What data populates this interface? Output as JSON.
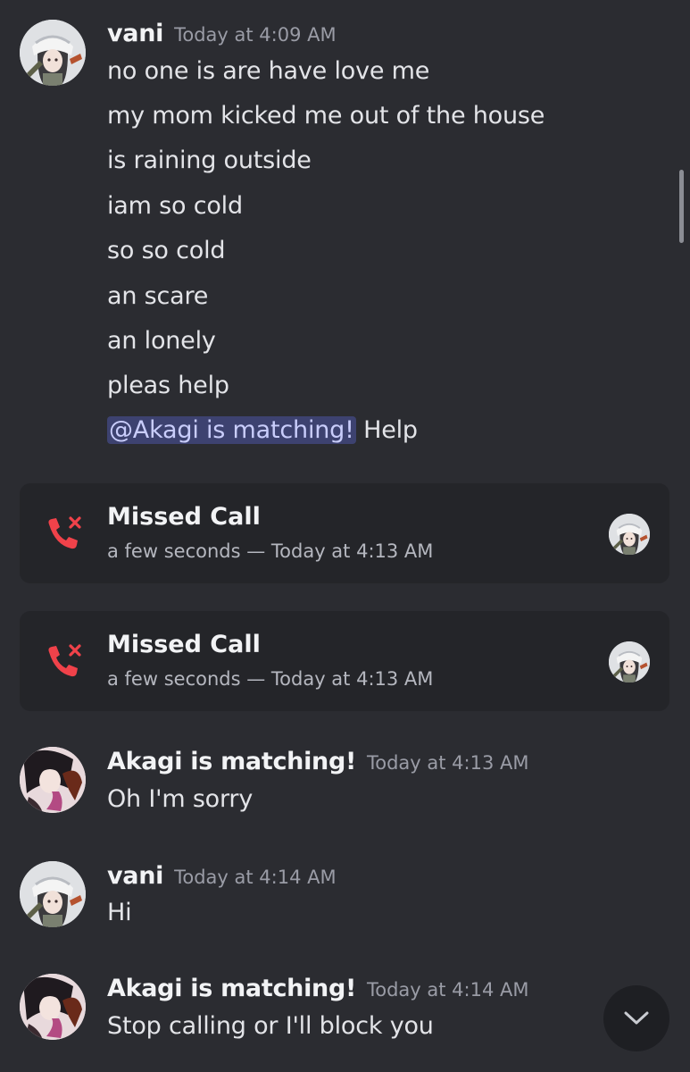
{
  "messages": [
    {
      "author": "vani",
      "timestamp": "Today at 4:09 AM",
      "lines": [
        "no one is are have love me",
        "my mom kicked me out of the house",
        "is raining outside",
        "iam so cold",
        "so so cold",
        "an scare",
        "an lonely",
        "pleas help"
      ],
      "mention": "@Akagi is matching!",
      "mention_trailing": "Help"
    },
    {
      "author": "Akagi is matching!",
      "timestamp": "Today at 4:13 AM",
      "lines": [
        "Oh I'm sorry"
      ]
    },
    {
      "author": "vani",
      "timestamp": "Today at 4:14 AM",
      "lines": [
        "Hi"
      ]
    },
    {
      "author": "Akagi is matching!",
      "timestamp": "Today at 4:14 AM",
      "lines": [
        "Stop calling or I'll block you"
      ]
    }
  ],
  "calls": [
    {
      "title": "Missed Call",
      "meta": "a few seconds — Today at 4:13 AM"
    },
    {
      "title": "Missed Call",
      "meta": "a few seconds — Today at 4:13 AM"
    }
  ],
  "icons": {
    "missed_call": "missed-call-icon",
    "jump_to_present": "chevron-down-icon"
  },
  "colors": {
    "background": "#2b2c31",
    "card": "#242529",
    "missed_call_red": "#f0424a",
    "mention_bg": "#3d4270",
    "mention_text": "#c9cdfb"
  }
}
